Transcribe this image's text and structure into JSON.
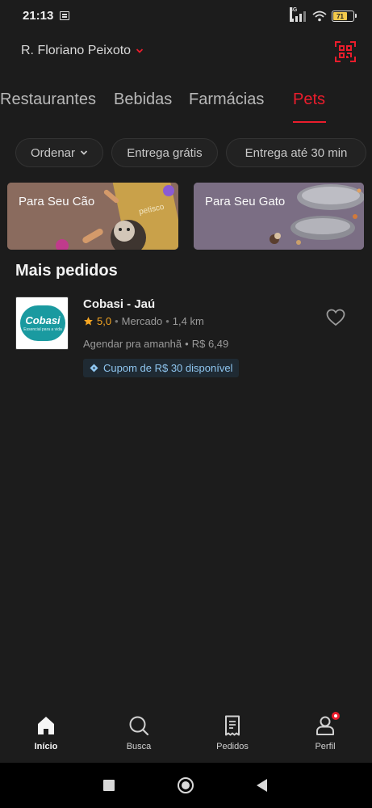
{
  "status_bar": {
    "time": "21:13",
    "network": "4G",
    "battery_level": 0.71,
    "battery_text": "71"
  },
  "header": {
    "address": "R. Floriano Peixoto",
    "address_icon": "chevron-down-icon",
    "qr_icon": "qr-scan-icon"
  },
  "tabs": [
    {
      "label": "Restaurantes",
      "active": false
    },
    {
      "label": "Bebidas",
      "active": false
    },
    {
      "label": "Farmácias",
      "active": false
    },
    {
      "label": "Pets",
      "active": true
    }
  ],
  "filters": {
    "sort_label": "Ordenar",
    "free_delivery_label": "Entrega grátis",
    "delivery_time_label": "Entrega até 30 min"
  },
  "banners": [
    {
      "label": "Para Seu Cão",
      "brand_text": "petisco"
    },
    {
      "label": "Para Seu Gato"
    }
  ],
  "section": {
    "title": "Mais pedidos"
  },
  "stores": [
    {
      "name": "Cobasi - Jaú",
      "logo_text": "Cobasi",
      "logo_tagline": "Essencial para a vida",
      "rating": "5,0",
      "category": "Mercado",
      "distance": "1,4 km",
      "schedule": "Agendar pra amanhã",
      "fee": "R$ 6,49",
      "coupon": "Cupom de R$ 30 disponível"
    }
  ],
  "bottom_nav": [
    {
      "label": "Início",
      "icon": "home-icon",
      "active": true
    },
    {
      "label": "Busca",
      "icon": "search-icon",
      "active": false
    },
    {
      "label": "Pedidos",
      "icon": "orders-icon",
      "active": false
    },
    {
      "label": "Perfil",
      "icon": "profile-icon",
      "active": false,
      "badge": true
    }
  ],
  "colors": {
    "accent": "#ea1d2c",
    "background": "#1c1c1c",
    "rating": "#f5a623",
    "coupon_text": "#8fc6f0"
  }
}
